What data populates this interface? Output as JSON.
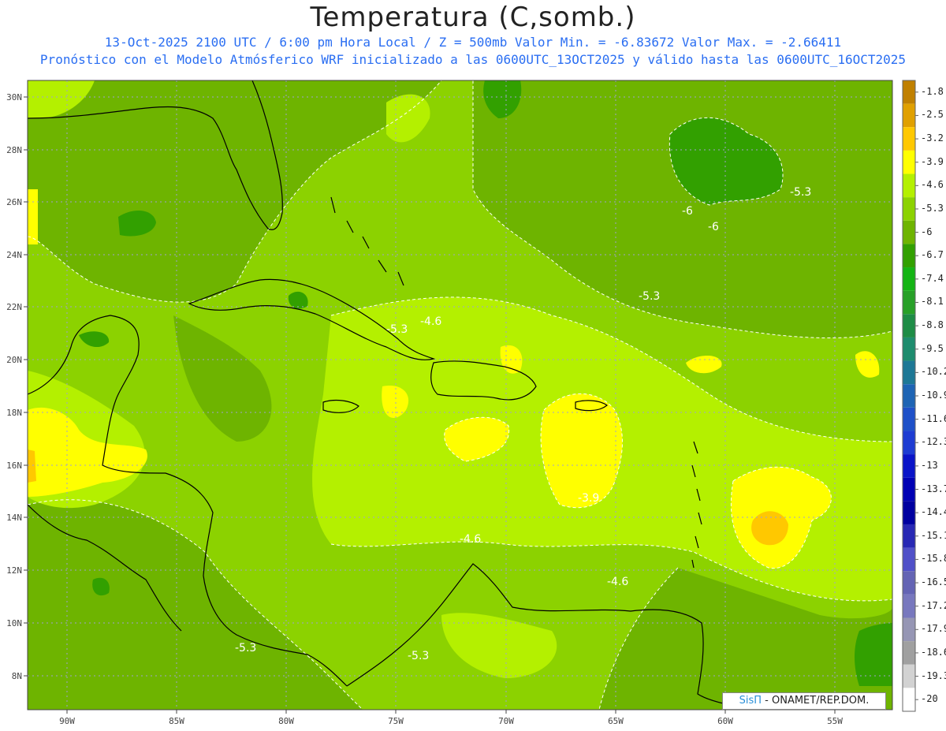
{
  "title": "Temperatura (C,somb.)",
  "subtitle_1": "13-Oct-2025  2100 UTC / 6:00 pm Hora Local / Z = 500mb  Valor Min. = -6.83672  Valor Max. = -2.66411",
  "subtitle_2": "Pronóstico con el Modelo Atmósferico WRF inicializado a las 0600UTC_13OCT2025 y válido hasta las  0600UTC_16OCT2025",
  "lat_labels": [
    "30N",
    "28N",
    "26N",
    "24N",
    "22N",
    "20N",
    "18N",
    "16N",
    "14N",
    "12N",
    "10N",
    "8N"
  ],
  "lon_labels": [
    "90W",
    "85W",
    "80W",
    "75W",
    "70W",
    "65W",
    "60W",
    "55W"
  ],
  "colorbar": {
    "labels": [
      "-1.8",
      "-2.5",
      "-3.2",
      "-3.9",
      "-4.6",
      "-5.3",
      "-6",
      "-6.7",
      "-7.4",
      "-8.1",
      "-8.8",
      "-9.5",
      "-10.2",
      "-10.9",
      "-11.6",
      "-12.3",
      "-13",
      "-13.7",
      "-14.4",
      "-15.1",
      "-15.8",
      "-16.5",
      "-17.2",
      "-17.9",
      "-18.6",
      "-19.3",
      "-20"
    ],
    "colors": [
      "#c08000",
      "#e0a000",
      "#ffc800",
      "#ffff00",
      "#b4f000",
      "#8cd200",
      "#6eb400",
      "#32a000",
      "#14b414",
      "#28a028",
      "#1e8c46",
      "#1e8c6e",
      "#1e7896",
      "#1e64b4",
      "#1e50c8",
      "#1e3cd2",
      "#0a14c8",
      "#0000b4",
      "#0000a0",
      "#2828b4",
      "#5050c8",
      "#6464b4",
      "#7878be",
      "#9696b4",
      "#a0a0a0",
      "#d2d2d2",
      "#ffffff"
    ]
  },
  "contour_labels": [
    "-5.3",
    "-6",
    "-6",
    "-5.3",
    "-5.3",
    "-4.6",
    "-3.9",
    "-4.6",
    "-4.6",
    "-5.3",
    "-5.3"
  ],
  "credit": {
    "brand": "SisΠ",
    "text": " - ONAMET/REP.DOM."
  }
}
